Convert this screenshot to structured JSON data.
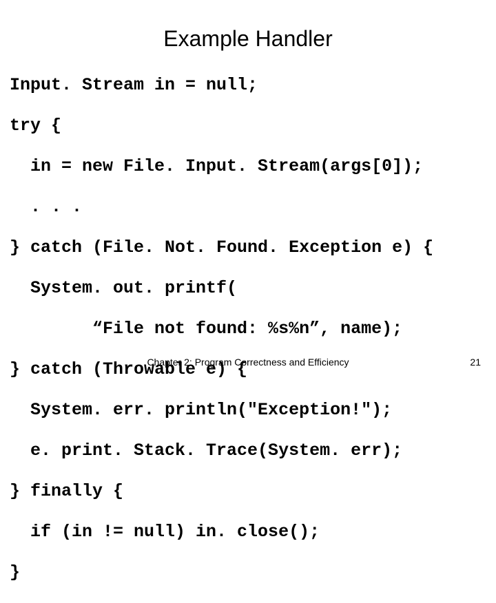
{
  "title": "Example Handler",
  "code_lines": [
    "Input. Stream in = null;",
    "try {",
    "  in = new File. Input. Stream(args[0]);",
    "  . . .",
    "} catch (File. Not. Found. Exception e) {",
    "  System. out. printf(",
    "        “File not found: %s%n”, name);",
    "} catch (Throwable e) {",
    "  System. err. println(\"Exception!\");",
    "  e. print. Stack. Trace(System. err);",
    "} finally {",
    "  if (in != null) in. close();",
    "}"
  ],
  "footer": "Chapter 2: Program Correctness and Efficiency",
  "page_number": "21"
}
